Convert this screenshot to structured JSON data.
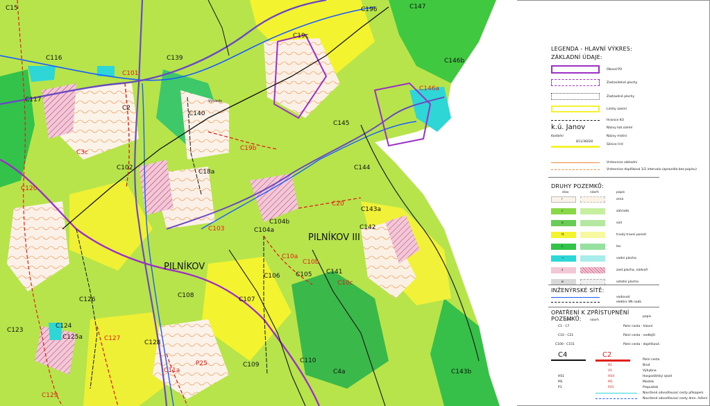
{
  "map": {
    "labels": {
      "c15": "C15",
      "c196": "C196",
      "c147": "C147",
      "c19c": "C19c",
      "c116": "C116",
      "c139": "C139",
      "c101": "C101",
      "c146b": "C146b",
      "c146a": "C146a",
      "c117": "C117",
      "c2": "C2",
      "c140": "C140",
      "c145": "C145",
      "c19b": "C19b",
      "c3c": "C3c",
      "c102": "C102",
      "c18a": "C18a",
      "c144": "C144",
      "c120": "C120",
      "c20": "C20",
      "c143a": "C143a",
      "c142": "C142",
      "c104b": "C104b",
      "c104a": "C104a",
      "c103": "C103",
      "c10a": "C10a",
      "c10b": "C10b",
      "c106": "C106",
      "c105": "C105",
      "c141": "C141",
      "c10c": "C10c",
      "c126": "C126",
      "c108": "C108",
      "c107": "C107",
      "c123": "C123",
      "c124": "C124",
      "c125a": "C125a",
      "c127": "C127",
      "c128": "C128",
      "c109": "C109",
      "c110": "C110",
      "c4a": "C4a",
      "c143b": "C143b",
      "c129": "C129",
      "c11a": "C11a",
      "p25": "P25",
      "pilnikov": "PILNÍKOV",
      "pilnikov3": "PILNÍKOV III",
      "vyhledy": "Výhledy",
      "kostelni": "k.ú. Janov"
    },
    "colors": {
      "green": "#a8e040",
      "yellow": "#f3f330",
      "cyan": "#2fd6d6",
      "violet": "#9c2fc4",
      "orange": "#f07a1a",
      "red": "#e0201a",
      "road": "#6a4ac0",
      "contour": "#ef8a3a"
    }
  },
  "legend": {
    "title": "LEGENDA - HLAVNÍ VÝKRES:",
    "basic_title": "ZÁKLADNÍ ÚDAJE:",
    "obvod": "Obvod PÚ",
    "zastavitelne": "Zastavitelné plochy",
    "zastavene": "Zastavěné plochy",
    "limity": "Limity území",
    "hranice": "Hranice KÚ",
    "ku_name": "k.ú. Janov",
    "ku_sub": "Kostelní",
    "ku_code": "811/36020",
    "nazvy_kat": "Názvy kat.území",
    "nazvy_mistni": "Názvy místní",
    "silnice": "Silnice II.tř.",
    "vrst_zakl": "Vrstevnice základní",
    "vrst_dopl": "Vrstevnice doplňková 1/2 intervalu (zpravidla bez popisu)",
    "druhy_title": "DRUHY POZEMKŮ:",
    "col_stav": "stav",
    "col_navrh": "návrh",
    "col_popis": "popis",
    "druhy": [
      {
        "code": "r",
        "label": "orná"
      },
      {
        "code": "c",
        "label": "zahrada"
      },
      {
        "code": "o",
        "label": "sad"
      },
      {
        "code": "tt",
        "label": "trvalý travní porost"
      },
      {
        "code": "L",
        "label": "les"
      },
      {
        "code": "~",
        "label": "vodní plocha"
      },
      {
        "code": "z",
        "label": "zast.plocha, nádvoří"
      },
      {
        "code": "ø",
        "label": "ostatní plocha"
      }
    ],
    "inz_title": "INŽENÝRSKÉ SÍTĚ:",
    "vodovod": "vodovod",
    "elektro": "elektro VN nadz.",
    "opatreni_title": "OPATŘENÍ K ZPŘÍSTUPNĚNÍ POZEMKŮ:",
    "op_stav": "stav",
    "op_navrh": "návrh",
    "op_popis": "popis",
    "op_rows": [
      {
        "code": "C1 - C7",
        "label": "Polní cesta - hlavní"
      },
      {
        "code": "C10 - C21",
        "label": "Polní cesta - vedlejší"
      },
      {
        "code": "C100 - C151",
        "label": "Polní cesta - doplňková"
      }
    ],
    "sym_c4": "C4",
    "sym_c2": "C2",
    "sym_rows": [
      {
        "left": "",
        "right": "",
        "label": "Polní cesta"
      },
      {
        "left": "",
        "right": "B1",
        "label": "Brod"
      },
      {
        "left": "",
        "right": "V1",
        "label": "Výhybna"
      },
      {
        "left": "HS1",
        "right": "HS4",
        "label": "Hospodářský sjezd"
      },
      {
        "left": "M1",
        "right": "M1",
        "label": "Mostek"
      },
      {
        "left": "P1",
        "right": "P25",
        "label": "Propustek"
      },
      {
        "left": "",
        "right": "",
        "label": "Navržené odvodňovací cesty příkopem"
      },
      {
        "left": "",
        "right": "",
        "label": "Navržené odvodňovací cesty dren. řešení"
      }
    ]
  }
}
